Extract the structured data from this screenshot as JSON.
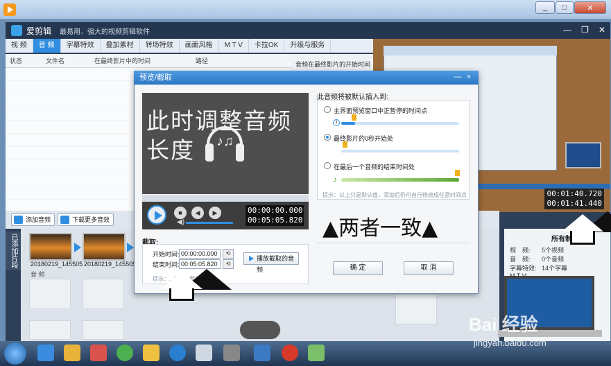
{
  "app": {
    "name": "爱剪辑",
    "slogan": "最易用、强大的视频剪辑软件"
  },
  "tabs": [
    {
      "label": "视 频",
      "active": false
    },
    {
      "label": "音 频",
      "active": true
    },
    {
      "label": "字幕特效",
      "active": false
    },
    {
      "label": "叠加素材",
      "active": false
    },
    {
      "label": "转场特效",
      "active": false
    },
    {
      "label": "画面风格",
      "active": false
    },
    {
      "label": "M T V",
      "active": false
    },
    {
      "label": "卡拉OK",
      "active": false
    },
    {
      "label": "升级与服务",
      "active": false
    }
  ],
  "table": {
    "headers": [
      "状态",
      "文件名",
      "在最终影片中的时间",
      "路径"
    ]
  },
  "right_panel": {
    "label": "音频在最终影片的开始时间"
  },
  "preview_times": {
    "current": "00:01:40.720",
    "total": "00:01:41.440"
  },
  "toolbar": {
    "add_audio": "添加音频",
    "download_more": "下载更多音效"
  },
  "side_label": "已添加片段",
  "clips": [
    {
      "name": "20180219_145505"
    },
    {
      "name": "20180219_145505"
    }
  ],
  "audio_track_label": "音 频",
  "info_panel": {
    "title": "所有制作的",
    "rows": [
      {
        "label": "视　频:",
        "value": "5个视频"
      },
      {
        "label": "音　频:",
        "value": "0个音频"
      },
      {
        "label": "字幕特效:",
        "value": "14个字幕"
      },
      {
        "label": "M T V:",
        "value": ""
      }
    ]
  },
  "dialog": {
    "title": "预览/截取",
    "close_symbol": "×",
    "video_text_line1": "此时调整音频",
    "video_text_line2": "长度",
    "time_current": "00:00:00.000",
    "time_total": "00:05:05.820",
    "cut_label": "截取:",
    "start_label": "开始时间:",
    "start_value": "00:00:00.000",
    "end_label": "结束时间:",
    "end_value": "00:05:05.820",
    "play_cut": "播放截取的音频",
    "cut_hint": "提示：...可...入整段音频",
    "insert_label": "此音频将被默认插入到:",
    "options": [
      {
        "label": "主界面预览窗口中正暂停的时间点",
        "checked": false
      },
      {
        "label": "最终影片的0秒开始处",
        "checked": true
      },
      {
        "label": "在最后一个音频的结束时间处",
        "checked": false
      }
    ],
    "insert_hint": "提示：以上只是默认值，添加后仍可自行修改成任意时间点",
    "ok": "确 定",
    "cancel": "取 消",
    "annotation": "▲两者一致▲"
  },
  "watermark": {
    "main": "Bai 经验",
    "sub": "jingyan.baidu.com"
  }
}
